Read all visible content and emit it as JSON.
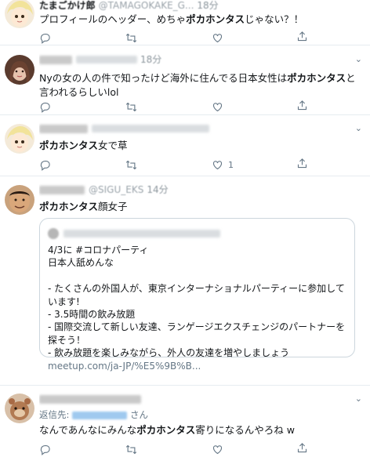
{
  "tweets": [
    {
      "name_visible": "たまごかけ郎",
      "handle": "@TAMAGOKAKE_G...",
      "time": "18分",
      "text_before": "プロフィールのヘッダー、めちゃ",
      "highlight": "ポカホンタス",
      "text_after": "じゃない？！"
    },
    {
      "time": "18分",
      "text_before": "Nyの女の人の件で知ったけど海外に住んでる日本女性は",
      "highlight": "ポカホンタス",
      "text_after": "と言われるらしいlol"
    },
    {
      "highlight": "ポカホンタス",
      "text_after": "女で草",
      "retweet_count": "1"
    },
    {
      "handle": "@SIGU_EKS",
      "time": "14分",
      "highlight": "ポカホンタス",
      "text_after": "顔女子",
      "card": {
        "text": "4/3に #コロナパーティ\n日本人舐めんな\n\n- たくさんの外国人が、東京インターナショナルパーティーに参加しています!\n- 3.5時間の飲み放題\n- 国際交流して新しい友達、ランゲージエクスチェンジのパートナーを探そう！\n- 飲み放題を楽しみながら、外人の友達を増やしましょう",
        "link": "meetup.com/ja-JP/%E5%9B%B..."
      }
    },
    {
      "reply_prefix": "返信先:",
      "reply_suffix": "さん",
      "text_before": "なんであんなにみんな",
      "highlight": "ポカホンタス",
      "text_after": "寄りになるんやろね w"
    }
  ],
  "icons": [
    "reply-icon",
    "retweet-icon",
    "like-icon",
    "share-icon",
    "chevron-down-icon"
  ],
  "colors": {
    "icon": "#657786",
    "border": "#e6ecf0",
    "text": "#14171a",
    "secondary": "#657786"
  }
}
